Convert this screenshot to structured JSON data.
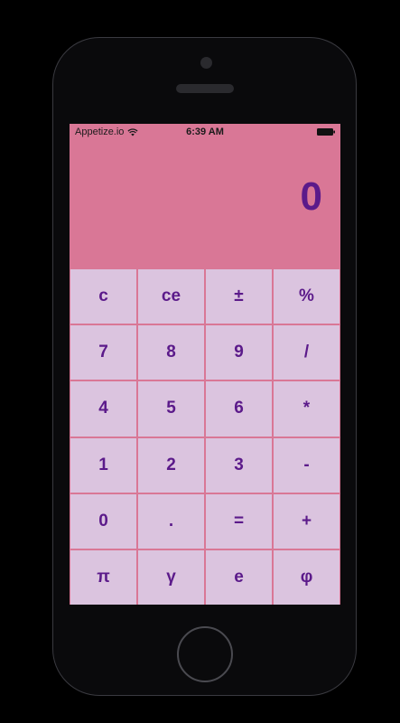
{
  "status_bar": {
    "carrier": "Appetize.io",
    "time": "6:39 AM",
    "wifi_icon": "wifi-icon",
    "battery_icon": "battery-full-icon"
  },
  "display": {
    "value": "0"
  },
  "colors": {
    "screen_background": "#d97796",
    "key_background": "#dbc4df",
    "key_text": "#5b1a8a",
    "display_text": "#5b1a8a"
  },
  "keypad": {
    "rows": [
      [
        {
          "label": "c",
          "name": "clear-key"
        },
        {
          "label": "ce",
          "name": "clear-entry-key"
        },
        {
          "label": "±",
          "name": "sign-toggle-key"
        },
        {
          "label": "%",
          "name": "percent-key"
        }
      ],
      [
        {
          "label": "7",
          "name": "digit-7-key"
        },
        {
          "label": "8",
          "name": "digit-8-key"
        },
        {
          "label": "9",
          "name": "digit-9-key"
        },
        {
          "label": "/",
          "name": "divide-key"
        }
      ],
      [
        {
          "label": "4",
          "name": "digit-4-key"
        },
        {
          "label": "5",
          "name": "digit-5-key"
        },
        {
          "label": "6",
          "name": "digit-6-key"
        },
        {
          "label": "*",
          "name": "multiply-key"
        }
      ],
      [
        {
          "label": "1",
          "name": "digit-1-key"
        },
        {
          "label": "2",
          "name": "digit-2-key"
        },
        {
          "label": "3",
          "name": "digit-3-key"
        },
        {
          "label": "-",
          "name": "subtract-key"
        }
      ],
      [
        {
          "label": "0",
          "name": "digit-0-key"
        },
        {
          "label": ".",
          "name": "decimal-key"
        },
        {
          "label": "=",
          "name": "equals-key"
        },
        {
          "label": "+",
          "name": "add-key"
        }
      ],
      [
        {
          "label": "π",
          "name": "pi-key"
        },
        {
          "label": "γ",
          "name": "gamma-key"
        },
        {
          "label": "e",
          "name": "euler-key"
        },
        {
          "label": "φ",
          "name": "phi-key"
        }
      ]
    ]
  }
}
